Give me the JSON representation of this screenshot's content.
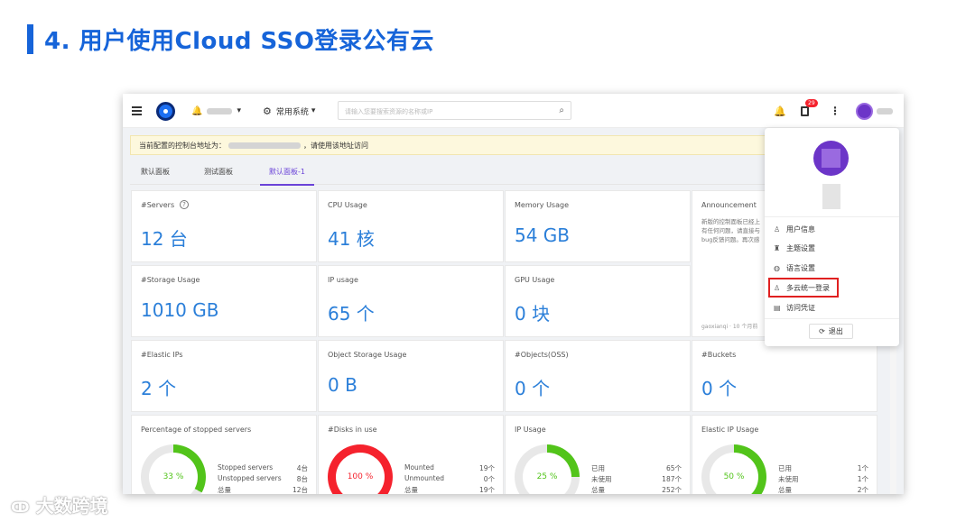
{
  "slide": {
    "title": "4. 用户使用Cloud SSO登录公有云"
  },
  "topbar": {
    "nav_label": "常用系统",
    "search_placeholder": "请输入您要搜索资源的名称或IP",
    "badge": "29"
  },
  "notice": {
    "prefix": "当前配置的控制台地址为：",
    "suffix": "，请使用该地址访问"
  },
  "tabs": [
    "默认面板",
    "测试面板",
    "默认面板-1"
  ],
  "cards": [
    {
      "label": "#Servers",
      "value": "12 台"
    },
    {
      "label": "CPU Usage",
      "value": "41 核"
    },
    {
      "label": "Memory Usage",
      "value": "54 GB"
    },
    {
      "label": "#Storage Usage",
      "value": "1010 GB"
    },
    {
      "label": "IP usage",
      "value": "65 个"
    },
    {
      "label": "GPU Usage",
      "value": "0 块"
    },
    {
      "label": "#Elastic IPs",
      "value": "2 个"
    },
    {
      "label": "Object Storage Usage",
      "value": "0 B"
    },
    {
      "label": "#Objects(OSS)",
      "value": "0 个"
    },
    {
      "label": "#Buckets",
      "value": "0 个"
    }
  ],
  "announcement": {
    "label": "Announcement",
    "lines": [
      "新版的控制面板已经上",
      "有任何问题，请直接与",
      "bug反馈问题。再次感"
    ],
    "author": "gaoxianqi · 10 个月前"
  },
  "charts": [
    {
      "label": "Percentage of stopped servers",
      "percent": "33 %",
      "fraction": 0.33,
      "color": "#52c41a",
      "rows": [
        [
          "Stopped servers",
          "4台"
        ],
        [
          "Unstopped servers",
          "8台"
        ],
        [
          "总量",
          "12台"
        ]
      ]
    },
    {
      "label": "#Disks in use",
      "percent": "100 %",
      "fraction": 1.0,
      "color": "#f5222d",
      "rows": [
        [
          "Mounted",
          "19个"
        ],
        [
          "Unmounted",
          "0个"
        ],
        [
          "总量",
          "19个"
        ]
      ]
    },
    {
      "label": "IP Usage",
      "percent": "25 %",
      "fraction": 0.25,
      "color": "#52c41a",
      "rows": [
        [
          "已用",
          "65个"
        ],
        [
          "未使用",
          "187个"
        ],
        [
          "总量",
          "252个"
        ]
      ]
    },
    {
      "label": "Elastic IP Usage",
      "percent": "50 %",
      "fraction": 0.5,
      "color": "#52c41a",
      "rows": [
        [
          "已用",
          "1个"
        ],
        [
          "未使用",
          "1个"
        ],
        [
          "总量",
          "2个"
        ]
      ]
    }
  ],
  "menu": {
    "items": [
      "用户信息",
      "主题设置",
      "语言设置",
      "多云统一登录",
      "访问凭证"
    ],
    "logout": "退出"
  },
  "watermark": "大数跨境"
}
